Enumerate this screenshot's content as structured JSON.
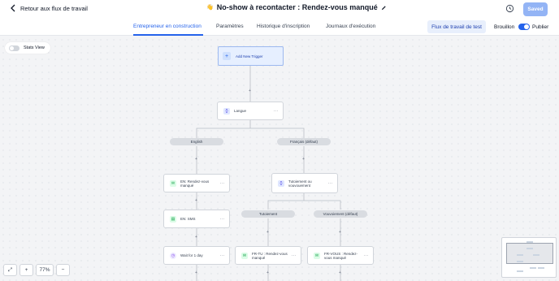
{
  "header": {
    "back_label": "Retour aux flux de travail",
    "title_emoji": "👋",
    "title": "No-show à recontacter  : Rendez-vous manqué",
    "saved_label": "Saved"
  },
  "tabs": [
    {
      "label": "Entrepreneur en construction"
    },
    {
      "label": "Paramètres"
    },
    {
      "label": "Historique d'inscription"
    },
    {
      "label": "Journaux d'exécution"
    }
  ],
  "toolbar": {
    "test_label": "Flux de travail de test",
    "draft_label": "Brouillon",
    "publish_label": "Publier"
  },
  "stats": {
    "label": "Stats View"
  },
  "trigger": {
    "label": "Add New Trigger"
  },
  "nodes": {
    "langue": "Langue",
    "en_email": "EN: Rendez-vous manqué",
    "en_sms": "EN: SMS",
    "wait": "Wait for 1 day",
    "cond_tu": "Tutoiement ou vouvouement",
    "fr_tu": "FR-TU : Rendez-vous manqué",
    "fr_vous": "FR-VOUS : Rendez-vous manqué"
  },
  "branches": {
    "english": "English",
    "francais": "Français (défaut)",
    "tutoiement": "Tutoiement",
    "vouvoiement": "Vouvoiement (défaut)"
  },
  "zoom": {
    "level": "77%"
  },
  "colors": {
    "accent": "#2563eb",
    "saved_bg": "#93b4f5"
  }
}
